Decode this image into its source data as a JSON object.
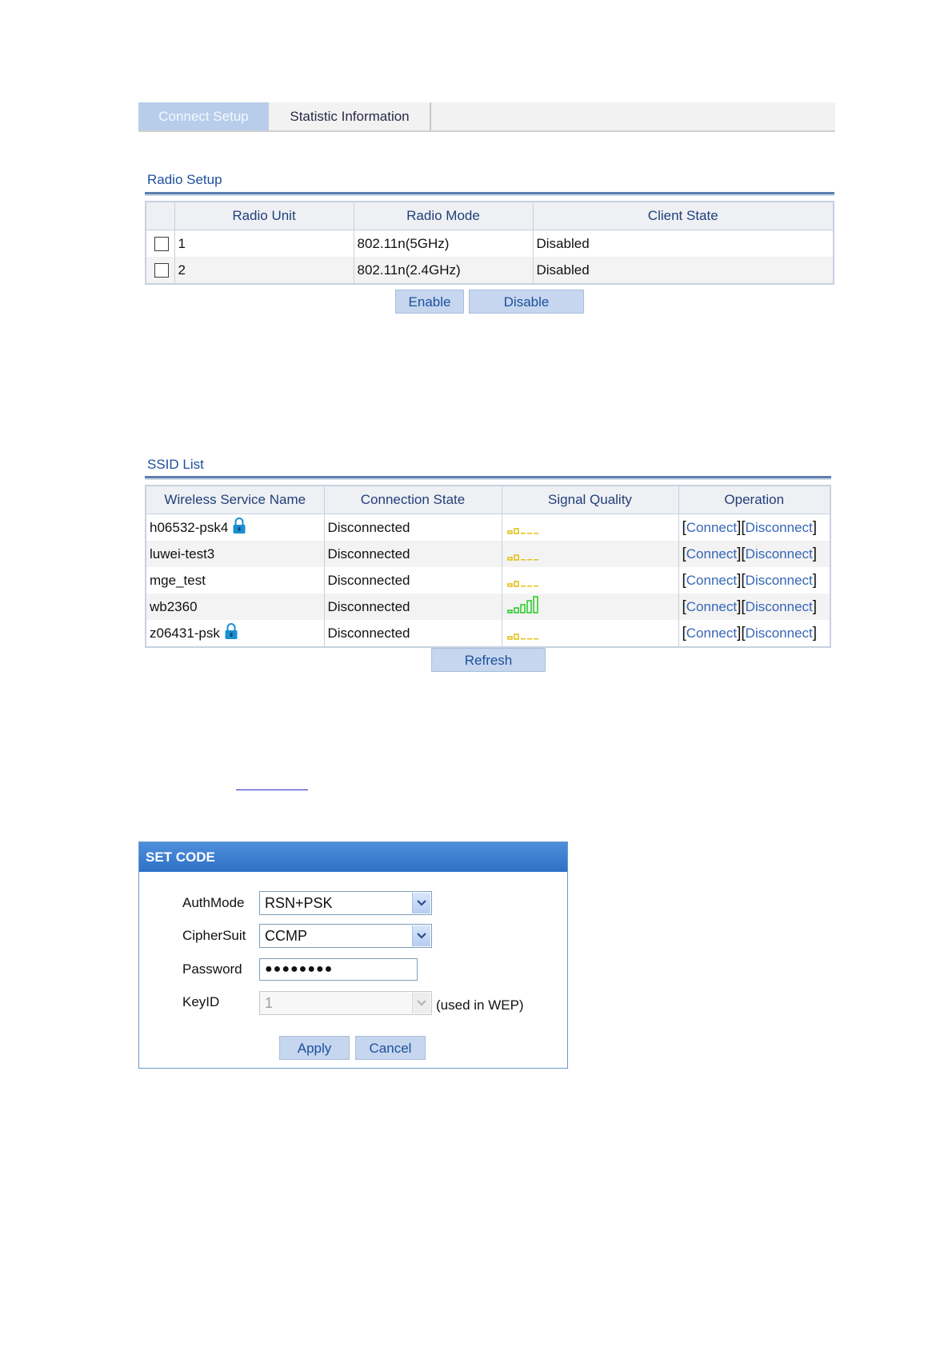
{
  "tabs": [
    {
      "label": "Connect Setup"
    },
    {
      "label": "Statistic Information"
    }
  ],
  "radio_setup": {
    "title": "Radio Setup",
    "columns": [
      "Radio Unit",
      "Radio Mode",
      "Client State"
    ],
    "rows": [
      {
        "unit": "1",
        "mode": "802.11n(5GHz)",
        "state": "Disabled"
      },
      {
        "unit": "2",
        "mode": "802.11n(2.4GHz)",
        "state": "Disabled"
      }
    ],
    "enable_label": "Enable",
    "disable_label": "Disable"
  },
  "ssid_list": {
    "title": "SSID List",
    "columns": [
      "Wireless Service Name",
      "Connection State",
      "Signal Quality",
      "Operation"
    ],
    "rows": [
      {
        "name": "h06532-psk4",
        "state": "Disconnected",
        "signal_bars": 2,
        "locked": true
      },
      {
        "name": "luwei-test3",
        "state": "Disconnected",
        "signal_bars": 2,
        "locked": false
      },
      {
        "name": "mge_test",
        "state": "Disconnected",
        "signal_bars": 2,
        "locked": false
      },
      {
        "name": "wb2360",
        "state": "Disconnected",
        "signal_bars": 5,
        "locked": false
      },
      {
        "name": "z06431-psk",
        "state": "Disconnected",
        "signal_bars": 2,
        "locked": true
      }
    ],
    "connect_label": "Connect",
    "disconnect_label": "Disconnect",
    "refresh_label": "Refresh"
  },
  "set_code": {
    "title": "SET CODE",
    "authmode_label": "AuthMode",
    "authmode_value": "RSN+PSK",
    "ciphersuit_label": "CipherSuit",
    "ciphersuit_value": "CCMP",
    "password_label": "Password",
    "password_value": "●●●●●●●●",
    "keyid_label": "KeyID",
    "keyid_value": "1",
    "keyid_note": "(used in WEP)",
    "apply_label": "Apply",
    "cancel_label": "Cancel"
  },
  "colors": {
    "accent": "#1e4f9c",
    "signal_weak": "#e0c21a",
    "signal_strong": "#2ecc2e",
    "lock": "#1b8fd0"
  }
}
